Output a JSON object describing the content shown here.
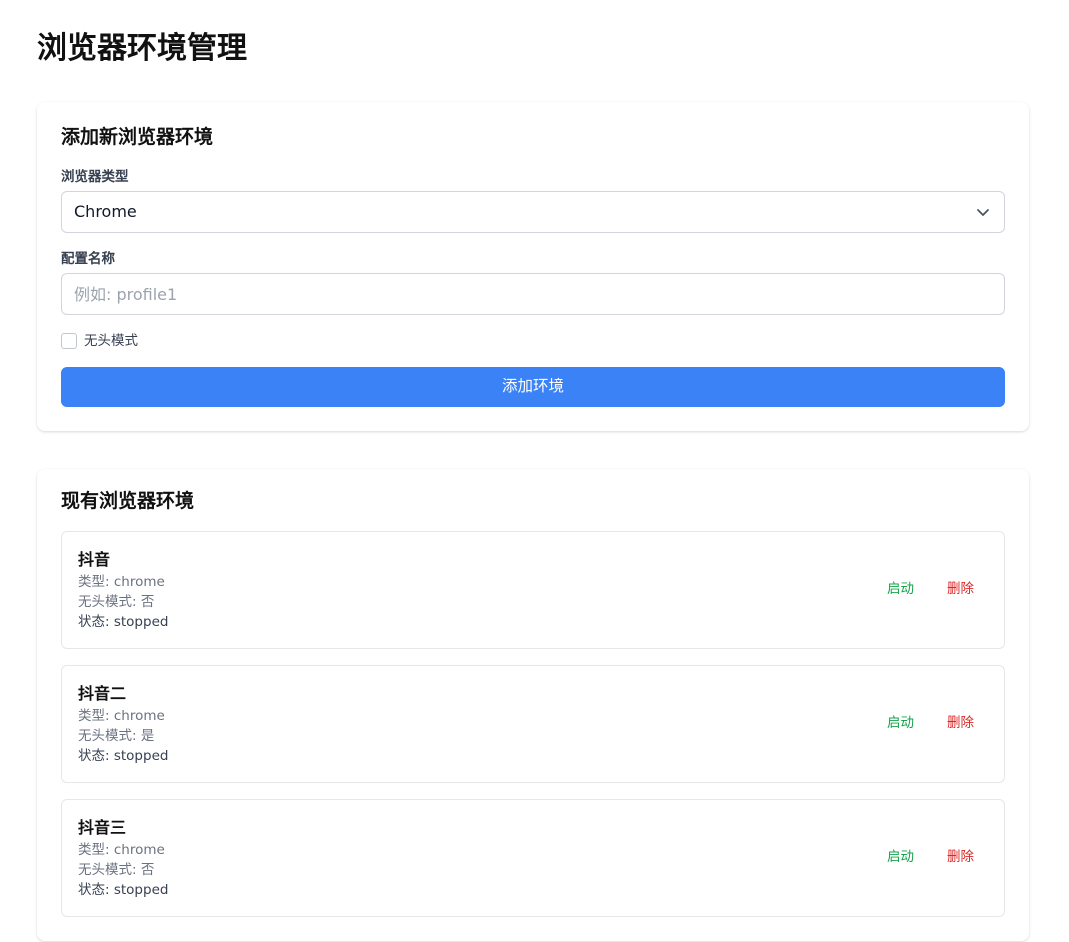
{
  "page": {
    "title": "浏览器环境管理"
  },
  "add_form": {
    "title": "添加新浏览器环境",
    "browser_type_label": "浏览器类型",
    "browser_type_value": "Chrome",
    "profile_name_label": "配置名称",
    "profile_name_value": "",
    "profile_name_placeholder": "例如: profile1",
    "headless_label": "无头模式",
    "headless_checked": false,
    "submit_label": "添加环境"
  },
  "env_list": {
    "title": "现有浏览器环境",
    "items": [
      {
        "name": "抖音",
        "type": "类型: chrome",
        "headless": "无头模式: 否",
        "status": "状态: stopped",
        "start_label": "启动",
        "delete_label": "删除"
      },
      {
        "name": "抖音二",
        "type": "类型: chrome",
        "headless": "无头模式: 是",
        "status": "状态: stopped",
        "start_label": "启动",
        "delete_label": "删除"
      },
      {
        "name": "抖音三",
        "type": "类型: chrome",
        "headless": "无头模式: 否",
        "status": "状态: stopped",
        "start_label": "启动",
        "delete_label": "删除"
      }
    ]
  },
  "colors": {
    "primary": "#3b82f6",
    "start": "#16a34a",
    "delete": "#dc2626"
  }
}
